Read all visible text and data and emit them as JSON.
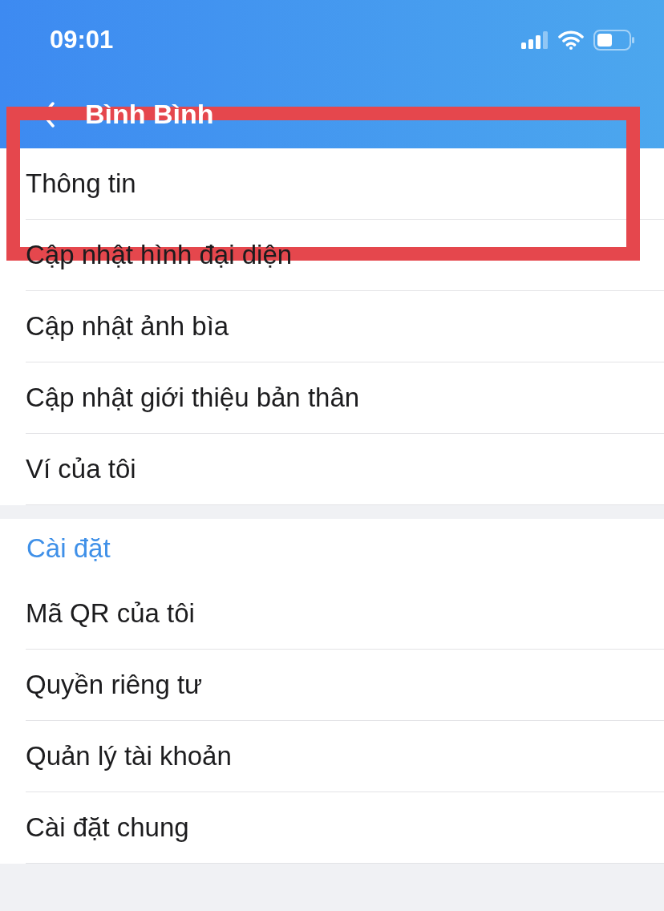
{
  "status_bar": {
    "time": "09:01"
  },
  "nav_bar": {
    "title": "Bình Bình"
  },
  "profile_items": [
    "Thông tin",
    "Cập nhật hình đại diện",
    "Cập nhật ảnh bìa",
    "Cập nhật giới thiệu bản thân",
    "Ví của tôi"
  ],
  "settings_section": {
    "header": "Cài đặt",
    "items": [
      "Mã QR của tôi",
      "Quyền riêng tư",
      "Quản lý tài khoản",
      "Cài đặt chung"
    ]
  },
  "annotation_frame": true
}
